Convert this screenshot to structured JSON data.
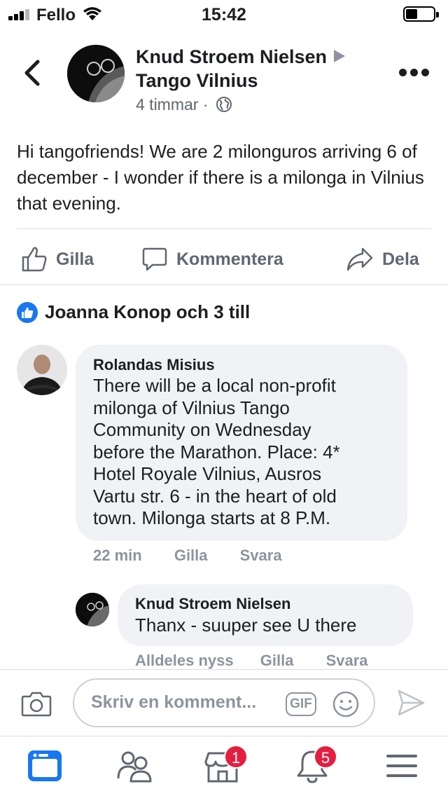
{
  "status_bar": {
    "carrier": "Fello",
    "time": "15:42"
  },
  "post": {
    "author": "Knud Stroem Nielsen",
    "group": "Tango Vilnius",
    "time": "4 timmar",
    "separator": "·",
    "text": "Hi tangofriends! We are 2 milonguros arriving 6 of december - I wonder if there is a milonga in Vilnius that evening.",
    "actions": {
      "like": "Gilla",
      "comment": "Kommentera",
      "share": "Dela"
    },
    "reactions": "Joanna Konop och 3 till"
  },
  "comments": [
    {
      "name": "Rolandas Misius",
      "lines": [
        "There will be a local non-profit",
        "milonga of Vilnius Tango",
        "Community on Wednesday",
        "before the Marathon. Place: 4*",
        "Hotel Royale Vilnius, Ausros",
        "Vartu str. 6 - in the heart of old",
        "town. Milonga starts at 8 P.M."
      ],
      "time": "22 min",
      "like": "Gilla",
      "reply": "Svara"
    },
    {
      "name": "Knud Stroem Nielsen",
      "text": "Thanx - suuper see U there",
      "time": "Alldeles nyss",
      "like": "Gilla",
      "reply": "Svara"
    }
  ],
  "composer": {
    "placeholder": "Skriv en komment...",
    "gif": "GIF"
  },
  "tabbar": {
    "marketplace_badge": "1",
    "notifications_badge": "5"
  },
  "colors": {
    "accent": "#1877f2",
    "badge": "#e41e3f",
    "secondary_text": "#606770",
    "bubble": "#f0f2f5"
  }
}
